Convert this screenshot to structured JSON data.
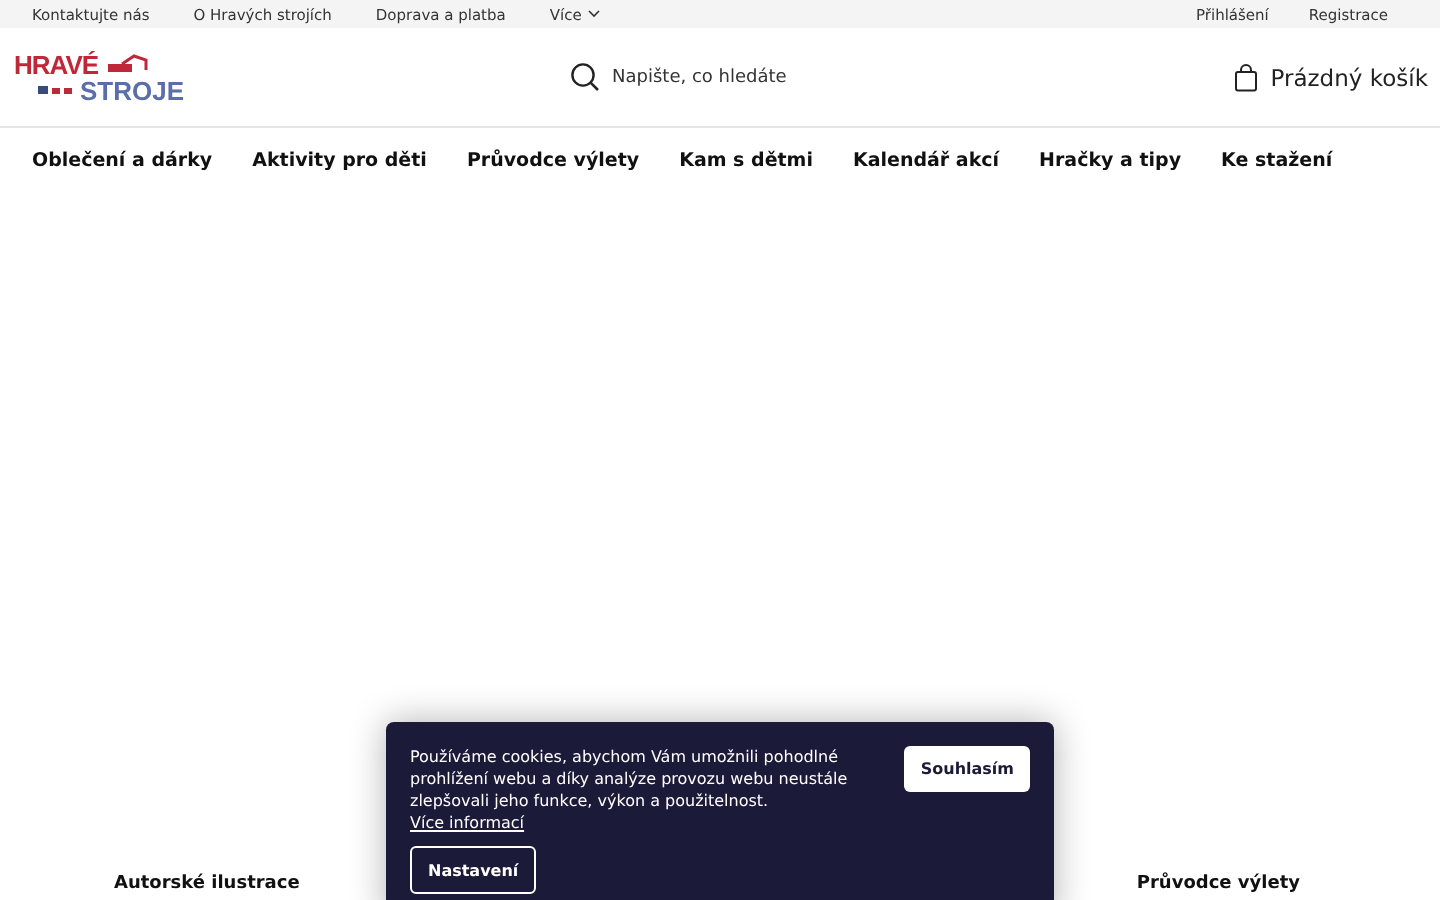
{
  "top_links": [
    "Kontaktujte nás",
    "O Hravých strojích",
    "Doprava a platba",
    "Více"
  ],
  "account_links": [
    "Přihlášení",
    "Registrace"
  ],
  "logo": {
    "line_1": "HRAVÉ",
    "line_2": "STROJE"
  },
  "search": {
    "placeholder": "Napište, co hledáte"
  },
  "cart": {
    "label": "Prázdný košík"
  },
  "nav": [
    "Oblečení a dárky",
    "Aktivity pro děti",
    "Průvodce výlety",
    "Kam s dětmi",
    "Kalendář akcí",
    "Hračky a tipy",
    "Ke stažení"
  ],
  "footer_headings": [
    "Autorské ilustrace",
    "Průvodce výlety"
  ],
  "cookie_banner": {
    "text": "Používáme cookies, abychom Vám umožnili pohodlné prohlížení webu a díky analýze provozu webu neustále zlepšovali jeho funkce, výkon a použitelnost.",
    "link": "Více informací",
    "accept": "Souhlasím",
    "settings": "Nastavení"
  }
}
